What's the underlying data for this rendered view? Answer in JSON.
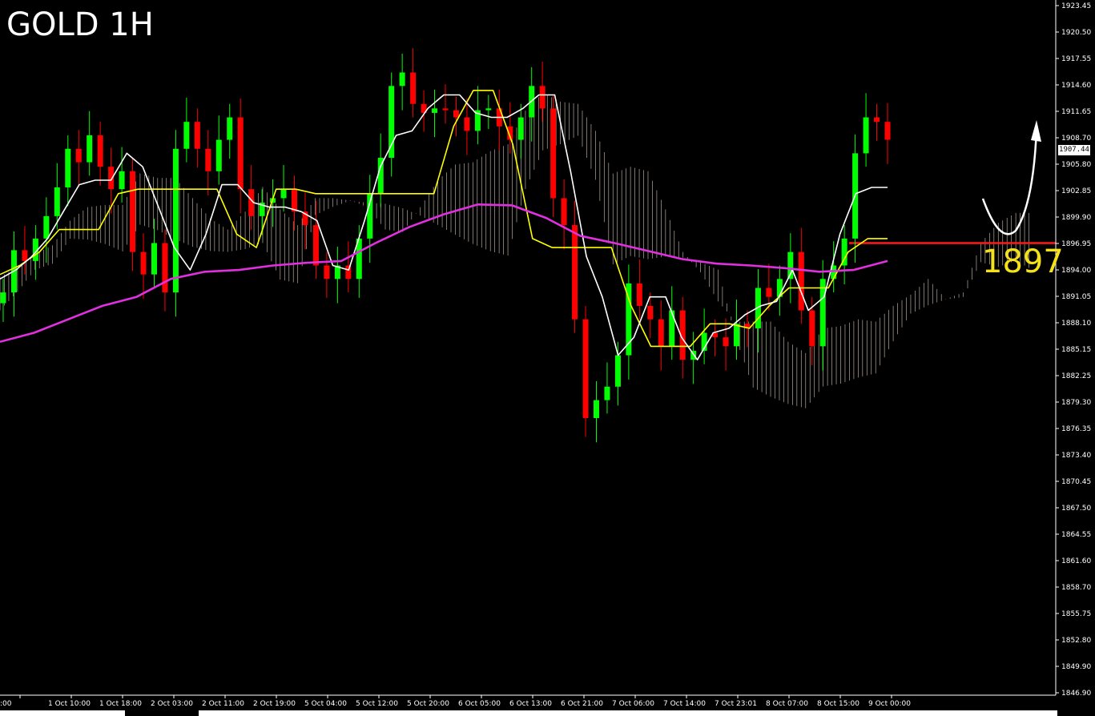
{
  "header": {
    "title": "GOLD 1H"
  },
  "annotation": {
    "level_label": "1897",
    "level_color": "#ff1a1a",
    "label_color": "#f5e11a"
  },
  "current_price": "1907.44",
  "colors": {
    "bull": "#00ff00",
    "bear": "#ff0000",
    "tenkan": "#ffffff",
    "kijun": "#ffff00",
    "ma": "#e030e0",
    "cloud_hatch": "#d9c9b9",
    "background": "#000000",
    "axis": "#ffffff"
  },
  "chart_data": {
    "type": "line",
    "title": "GOLD 1H",
    "ylim": [
      1846.9,
      1923.45
    ],
    "y_ticks": [
      "1923.45",
      "1920.50",
      "1917.55",
      "1914.60",
      "1911.65",
      "1908.70",
      "1905.80",
      "1902.85",
      "1899.90",
      "1896.95",
      "1894.00",
      "1891.05",
      "1888.10",
      "1885.15",
      "1882.25",
      "1879.30",
      "1876.35",
      "1873.40",
      "1870.45",
      "1867.50",
      "1864.55",
      "1861.60",
      "1858.70",
      "1855.75",
      "1852.80",
      "1849.90",
      "1846.90"
    ],
    "x_ticks": [
      ":00",
      "1 Oct 10:00",
      "1 Oct 18:00",
      "2 Oct 03:00",
      "2 Oct 11:00",
      "2 Oct 19:00",
      "5 Oct 04:00",
      "5 Oct 12:00",
      "5 Oct 20:00",
      "6 Oct 05:00",
      "6 Oct 13:00",
      "6 Oct 21:00",
      "7 Oct 06:00",
      "7 Oct 14:00",
      "7 Oct 23:01",
      "8 Oct 07:00",
      "8 Oct 15:00",
      "9 Oct 00:00"
    ],
    "horizontal_line": 1897,
    "last_price": 1907.44,
    "series": [
      {
        "name": "",
        "kind": "close",
        "values": [
          1891.5,
          1896.2,
          1895.0,
          1897.5,
          1900.0,
          1903.2,
          1907.5,
          1906.0,
          1909.0,
          1905.5,
          1903.0,
          1905.0,
          1896.0,
          1893.5,
          1897.0,
          1891.5,
          1907.5,
          1910.5,
          1907.5,
          1905.0,
          1908.5,
          1911.0,
          1903.0,
          1900.0,
          1901.5,
          1902.0,
          1903.0,
          1900.5,
          1899.0,
          1894.5,
          1893.0,
          1894.5,
          1893.0,
          1897.5,
          1902.5,
          1906.5,
          1914.5,
          1916.0,
          1912.5,
          1911.5,
          1912.0,
          1911.8,
          1911.0,
          1909.5,
          1911.8,
          1912.0,
          1910.0,
          1908.5,
          1911.0,
          1914.5,
          1912.0,
          1902.0,
          1899.0,
          1888.5,
          1877.5,
          1879.5,
          1881.0,
          1884.5,
          1892.5,
          1890.0,
          1888.5,
          1885.5,
          1889.5,
          1884.0,
          1885.0,
          1887.0,
          1886.5,
          1885.5,
          1888.0,
          1887.5,
          1892.0,
          1891.0,
          1893.0,
          1896.0,
          1889.5,
          1885.5,
          1893.0,
          1894.5,
          1897.5,
          1907.0,
          1911.0,
          1910.5,
          1908.5
        ]
      },
      {
        "name": "",
        "kind": "tenkan",
        "values": [
          1893.0,
          1894.0,
          1895.5,
          1897.5,
          1900.5,
          1903.5,
          1904.0,
          1904.0,
          1907.0,
          1905.5,
          1901.0,
          1896.5,
          1894.0,
          1898.0,
          1903.5,
          1903.5,
          1901.5,
          1901.0,
          1901.0,
          1900.5,
          1899.5,
          1894.5,
          1894.0,
          1899.5,
          1905.5,
          1909.0,
          1909.5,
          1912.0,
          1913.5,
          1913.5,
          1911.5,
          1911.0,
          1911.0,
          1912.0,
          1913.5,
          1913.5,
          1905.0,
          1895.5,
          1891.0,
          1884.5,
          1886.5,
          1891.0,
          1891.0,
          1886.5,
          1884.0,
          1887.0,
          1887.5,
          1889.0,
          1890.0,
          1890.5,
          1894.0,
          1889.5,
          1891.0,
          1898.0,
          1902.5,
          1903.2,
          1903.2
        ]
      },
      {
        "name": "",
        "kind": "kijun",
        "values": [
          1893.5,
          1894.5,
          1896.0,
          1898.5,
          1898.5,
          1898.5,
          1902.5,
          1903.0,
          1903.0,
          1903.0,
          1903.0,
          1903.0,
          1898.0,
          1896.5,
          1903.0,
          1903.0,
          1902.5,
          1902.5,
          1902.5,
          1902.5,
          1902.5,
          1902.5,
          1902.5,
          1910.0,
          1914.0,
          1914.0,
          1908.0,
          1897.5,
          1896.5,
          1896.5,
          1896.5,
          1896.5,
          1890.0,
          1885.5,
          1885.5,
          1885.5,
          1888.0,
          1888.0,
          1887.5,
          1890.0,
          1892.0,
          1892.0,
          1892.0,
          1896.0,
          1897.5,
          1897.5
        ]
      },
      {
        "name": "",
        "kind": "moving_average",
        "values": [
          1886.0,
          1887.0,
          1888.5,
          1890.0,
          1891.0,
          1893.0,
          1893.8,
          1894.0,
          1894.5,
          1894.8,
          1895.0,
          1897.0,
          1898.8,
          1900.2,
          1901.3,
          1901.2,
          1899.8,
          1897.8,
          1897.0,
          1896.1,
          1895.2,
          1894.7,
          1894.5,
          1894.2,
          1893.8,
          1894.0,
          1895.0
        ]
      }
    ]
  }
}
